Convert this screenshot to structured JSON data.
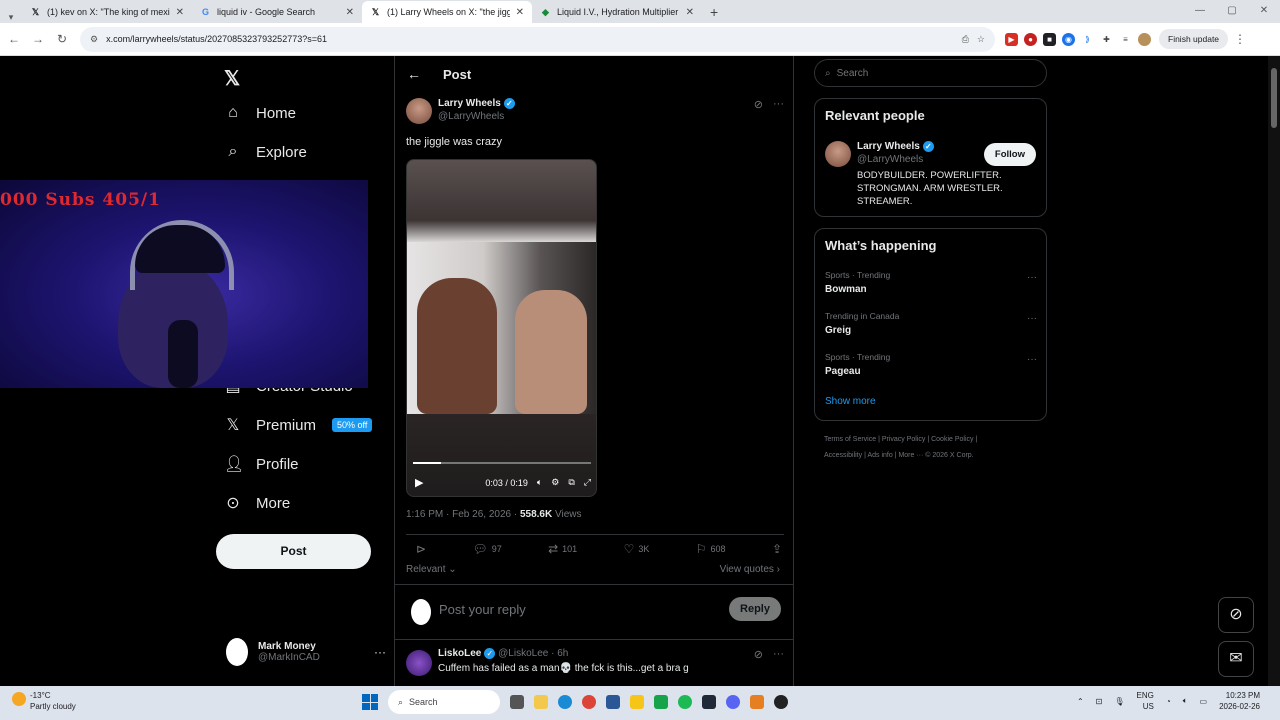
{
  "browser": {
    "tabs": [
      {
        "title": "(1) kev on X: \"The king of mexi",
        "icon": "x-icon",
        "active": false
      },
      {
        "title": "liquid iv - Google Search",
        "icon": "google-icon",
        "active": false
      },
      {
        "title": "(1) Larry Wheels on X: \"the jigg",
        "icon": "x-icon",
        "active": true
      },
      {
        "title": "Liquid I.V., Hydration Multiplier",
        "icon": "liquid-iv-icon",
        "active": false
      }
    ],
    "url": "x.com/larrywheels/status/2027085323793252773?s=61",
    "finish_update": "Finish update"
  },
  "nav": {
    "home": "Home",
    "explore": "Explore",
    "creator_studio": "Creator Studio",
    "premium": "Premium",
    "premium_badge": "50% off",
    "profile": "Profile",
    "more": "More",
    "post_button": "Post",
    "account_name": "Mark Money",
    "account_handle": "@MarkInCAD"
  },
  "webcam_overlay": "000 Subs  405/1",
  "main": {
    "header": "Post",
    "author_name": "Larry Wheels",
    "author_handle": "@LarryWheels",
    "text": "the jiggle was crazy",
    "video_time": "0:03 / 0:19",
    "video_progress": 0.16,
    "timestamp": "1:16 PM · Feb 26, 2026 · ",
    "views_count": "558.6K",
    "views_label": " Views",
    "replies": "97",
    "reposts": "101",
    "likes": "3K",
    "bookmarks": "608",
    "sort": "Relevant",
    "view_quotes": "View quotes",
    "reply_placeholder": "Post your reply",
    "reply_button": "Reply",
    "reply": {
      "name": "LiskoLee",
      "handle": "@LiskoLee · 6h",
      "text": "Cuffem has failed as a man💀 the fck is this...get a bra g"
    }
  },
  "sidebar": {
    "search_placeholder": "Search",
    "relevant_title": "Relevant people",
    "person_name": "Larry Wheels",
    "person_handle": "@LarryWheels",
    "person_bio": "BODYBUILDER. POWERLIFTER. STRONGMAN. ARM WRESTLER. STREAMER.",
    "follow": "Follow",
    "happening_title": "What’s happening",
    "trends": [
      {
        "context": "Sports · Trending",
        "name": "Bowman"
      },
      {
        "context": "Trending in Canada",
        "name": "Greig"
      },
      {
        "context": "Sports · Trending",
        "name": "Pageau"
      }
    ],
    "show_more": "Show more",
    "footer_line1": "Terms of Service  |  Privacy Policy  |  Cookie Policy  |",
    "footer_line2": "Accessibility  |  Ads info  |  More ···  © 2026 X Corp."
  },
  "taskbar": {
    "temp": "-13°C",
    "weather": "Partly cloudy",
    "search": "Search",
    "lang1": "ENG",
    "lang2": "US",
    "time": "10:23 PM",
    "date": "2026-02-26"
  },
  "colors": {
    "accent": "#1d9bf0",
    "background": "#000000",
    "border": "#2f3336"
  }
}
